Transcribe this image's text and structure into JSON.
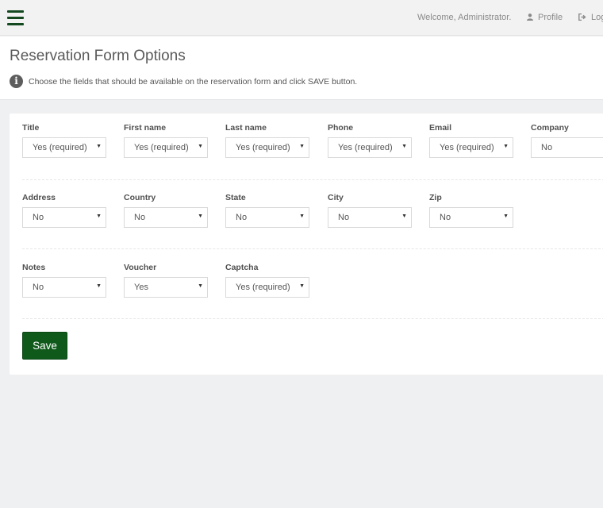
{
  "topbar": {
    "menu_icon": "hamburger-menu-icon",
    "welcome_text": "Welcome, Administrator.",
    "profile_label": "Profile",
    "profile_icon": "user-icon",
    "logout_label": "Log",
    "logout_icon": "sign-out-icon"
  },
  "header": {
    "title": "Reservation Form Options",
    "info_icon": "info-circle-icon",
    "description": "Choose the fields that should be available on the reservation form and click SAVE button."
  },
  "form": {
    "rows": [
      [
        {
          "label": "Title",
          "value": "Yes (required)"
        },
        {
          "label": "First name",
          "value": "Yes (required)"
        },
        {
          "label": "Last name",
          "value": "Yes (required)"
        },
        {
          "label": "Phone",
          "value": "Yes (required)"
        },
        {
          "label": "Email",
          "value": "Yes (required)"
        },
        {
          "label": "Company",
          "value": "No"
        }
      ],
      [
        {
          "label": "Address",
          "value": "No"
        },
        {
          "label": "Country",
          "value": "No"
        },
        {
          "label": "State",
          "value": "No"
        },
        {
          "label": "City",
          "value": "No"
        },
        {
          "label": "Zip",
          "value": "No"
        }
      ],
      [
        {
          "label": "Notes",
          "value": "No"
        },
        {
          "label": "Voucher",
          "value": "Yes"
        },
        {
          "label": "Captcha",
          "value": "Yes (required)"
        }
      ]
    ],
    "save_label": "Save"
  },
  "colors": {
    "accent": "#0f5a1b",
    "background": "#eff0f2",
    "panel": "#ffffff"
  }
}
